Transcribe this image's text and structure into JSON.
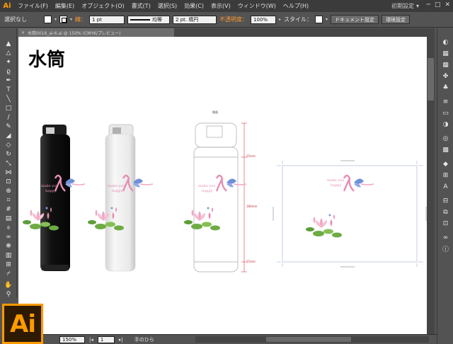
{
  "menubar": {
    "app_logo": "Ai",
    "items": [
      "ファイル(F)",
      "編集(E)",
      "オブジェクト(O)",
      "書式(T)",
      "選択(S)",
      "効果(C)",
      "表示(V)",
      "ウィンドウ(W)",
      "ヘルプ(H)"
    ],
    "workspace": "初期設定",
    "window_controls": [
      "─",
      "□",
      "✕"
    ]
  },
  "controlbar": {
    "selection": "選択なし",
    "stroke_label": "線：",
    "stroke_weight": "1 pt",
    "stroke_profile": "均等",
    "brush": "2 pt. 楕円",
    "opacity_label": "不透明度：",
    "opacity": "100%",
    "style_label": "スタイル：",
    "doc_setup_button": "ドキュメント設定",
    "prefs_button": "環境設定"
  },
  "doctab": {
    "close": "×",
    "title": "水筒0016_ai-6.ai @ 150% (CMYK/プレビュー)"
  },
  "canvas": {
    "title": "水筒",
    "bottle_text_line1": "make you",
    "bottle_text_line2": "happy",
    "dim_top": "25mm",
    "dim_mid": "184mm",
    "dim_bottom": "15mm",
    "spec_label": "側面"
  },
  "statusbar": {
    "zoom": "150%",
    "page": "1",
    "tool": "手のひら"
  },
  "badge": "Ai",
  "colors": {
    "accent": "#ff9a00",
    "ui_bg": "#535353",
    "menu_bg": "#3b3b3b",
    "ribbon": "#e78fb3",
    "butterfly": "#6f8fd8",
    "lotus": "#f2a7c4",
    "leaf": "#79b24a"
  }
}
